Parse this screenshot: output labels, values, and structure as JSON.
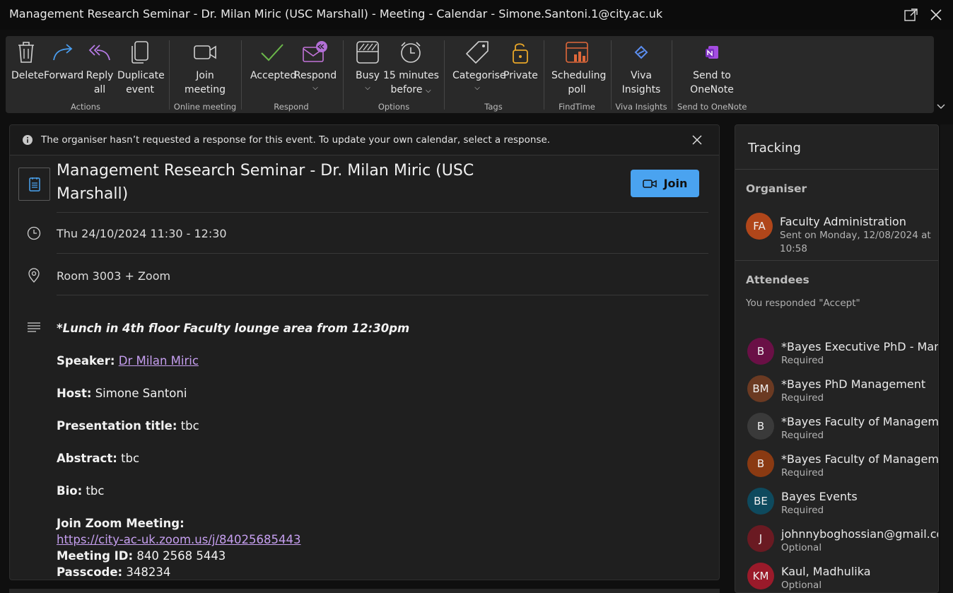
{
  "window": {
    "title": "Management Research Seminar - Dr. Milan Miric (USC Marshall) - Meeting - Calendar - Simone.Santoni.1@city.ac.uk"
  },
  "ribbon": {
    "actions": {
      "delete": "Delete",
      "forward": "Forward",
      "reply_all_1": "Reply",
      "reply_all_2": "all",
      "duplicate_1": "Duplicate",
      "duplicate_2": "event",
      "group": "Actions"
    },
    "online_meeting": {
      "join_1": "Join",
      "join_2": "meeting",
      "group": "Online meeting"
    },
    "respond": {
      "accepted": "Accepted",
      "respond": "Respond",
      "group": "Respond"
    },
    "options": {
      "busy": "Busy",
      "reminder_1": "15 minutes",
      "reminder_2": "before",
      "group": "Options"
    },
    "tags": {
      "categorise": "Categorise",
      "private": "Private",
      "group": "Tags"
    },
    "findtime": {
      "poll_1": "Scheduling",
      "poll_2": "poll",
      "group": "FindTime"
    },
    "viva": {
      "insights_1": "Viva",
      "insights_2": "Insights",
      "group": "Viva Insights"
    },
    "onenote": {
      "send_1": "Send to",
      "send_2": "OneNote",
      "group": "Send to OneNote"
    }
  },
  "event": {
    "info_message": "The organiser hasn’t requested a response for this event. To update your own calendar, select a response.",
    "title": "Management Research Seminar - Dr. Milan Miric (USC Marshall)",
    "join_label": "Join",
    "datetime": "Thu 24/10/2024 11:30 - 12:30",
    "location": "Room 3003 + Zoom",
    "body": {
      "lunch": "*Lunch in 4th floor Faculty lounge area from 12:30pm",
      "speaker_label": "Speaker:",
      "speaker": "Dr Milan Miric",
      "host_label": "Host:",
      "host": "Simone Santoni",
      "presentation_label": "Presentation title:",
      "presentation": "tbc",
      "abstract_label": "Abstract:",
      "abstract": "tbc",
      "bio_label": "Bio:",
      "bio": "tbc",
      "zoom_label": "Join Zoom Meeting:",
      "zoom_link": "https://city-ac-uk.zoom.us/j/84025685443",
      "meeting_id_label": "Meeting ID:",
      "meeting_id": "840 2568 5443",
      "passcode_label": "Passcode:",
      "passcode": "348234"
    }
  },
  "tracking": {
    "title": "Tracking",
    "organiser_label": "Organiser",
    "organiser": {
      "initials": "FA",
      "name": "Faculty Administration",
      "sent": "Sent on Monday, 12/08/2024 at 10:58",
      "color": "#b0461a"
    },
    "attendees_label": "Attendees",
    "response": "You responded \"Accept\"",
    "attendees": [
      {
        "initials": "B",
        "name": "*Bayes Executive PhD - Manag",
        "role": "Required",
        "color": "#6a1046"
      },
      {
        "initials": "BM",
        "name": "*Bayes PhD Management",
        "role": "Required",
        "color": "#6b3a22"
      },
      {
        "initials": "B",
        "name": "*Bayes Faculty of Managemer",
        "role": "Required",
        "color": "#3a3a3a"
      },
      {
        "initials": "B",
        "name": "*Bayes Faculty of Managemer",
        "role": "Required",
        "color": "#8a3a12"
      },
      {
        "initials": "BE",
        "name": "Bayes Events",
        "role": "Required",
        "color": "#0e4a5e"
      },
      {
        "initials": "J",
        "name": "johnnyboghossian@gmail.cor",
        "role": "Optional",
        "color": "#6a1a22"
      },
      {
        "initials": "KM",
        "name": "Kaul, Madhulika",
        "role": "Optional",
        "color": "#9a1a2a"
      }
    ]
  }
}
